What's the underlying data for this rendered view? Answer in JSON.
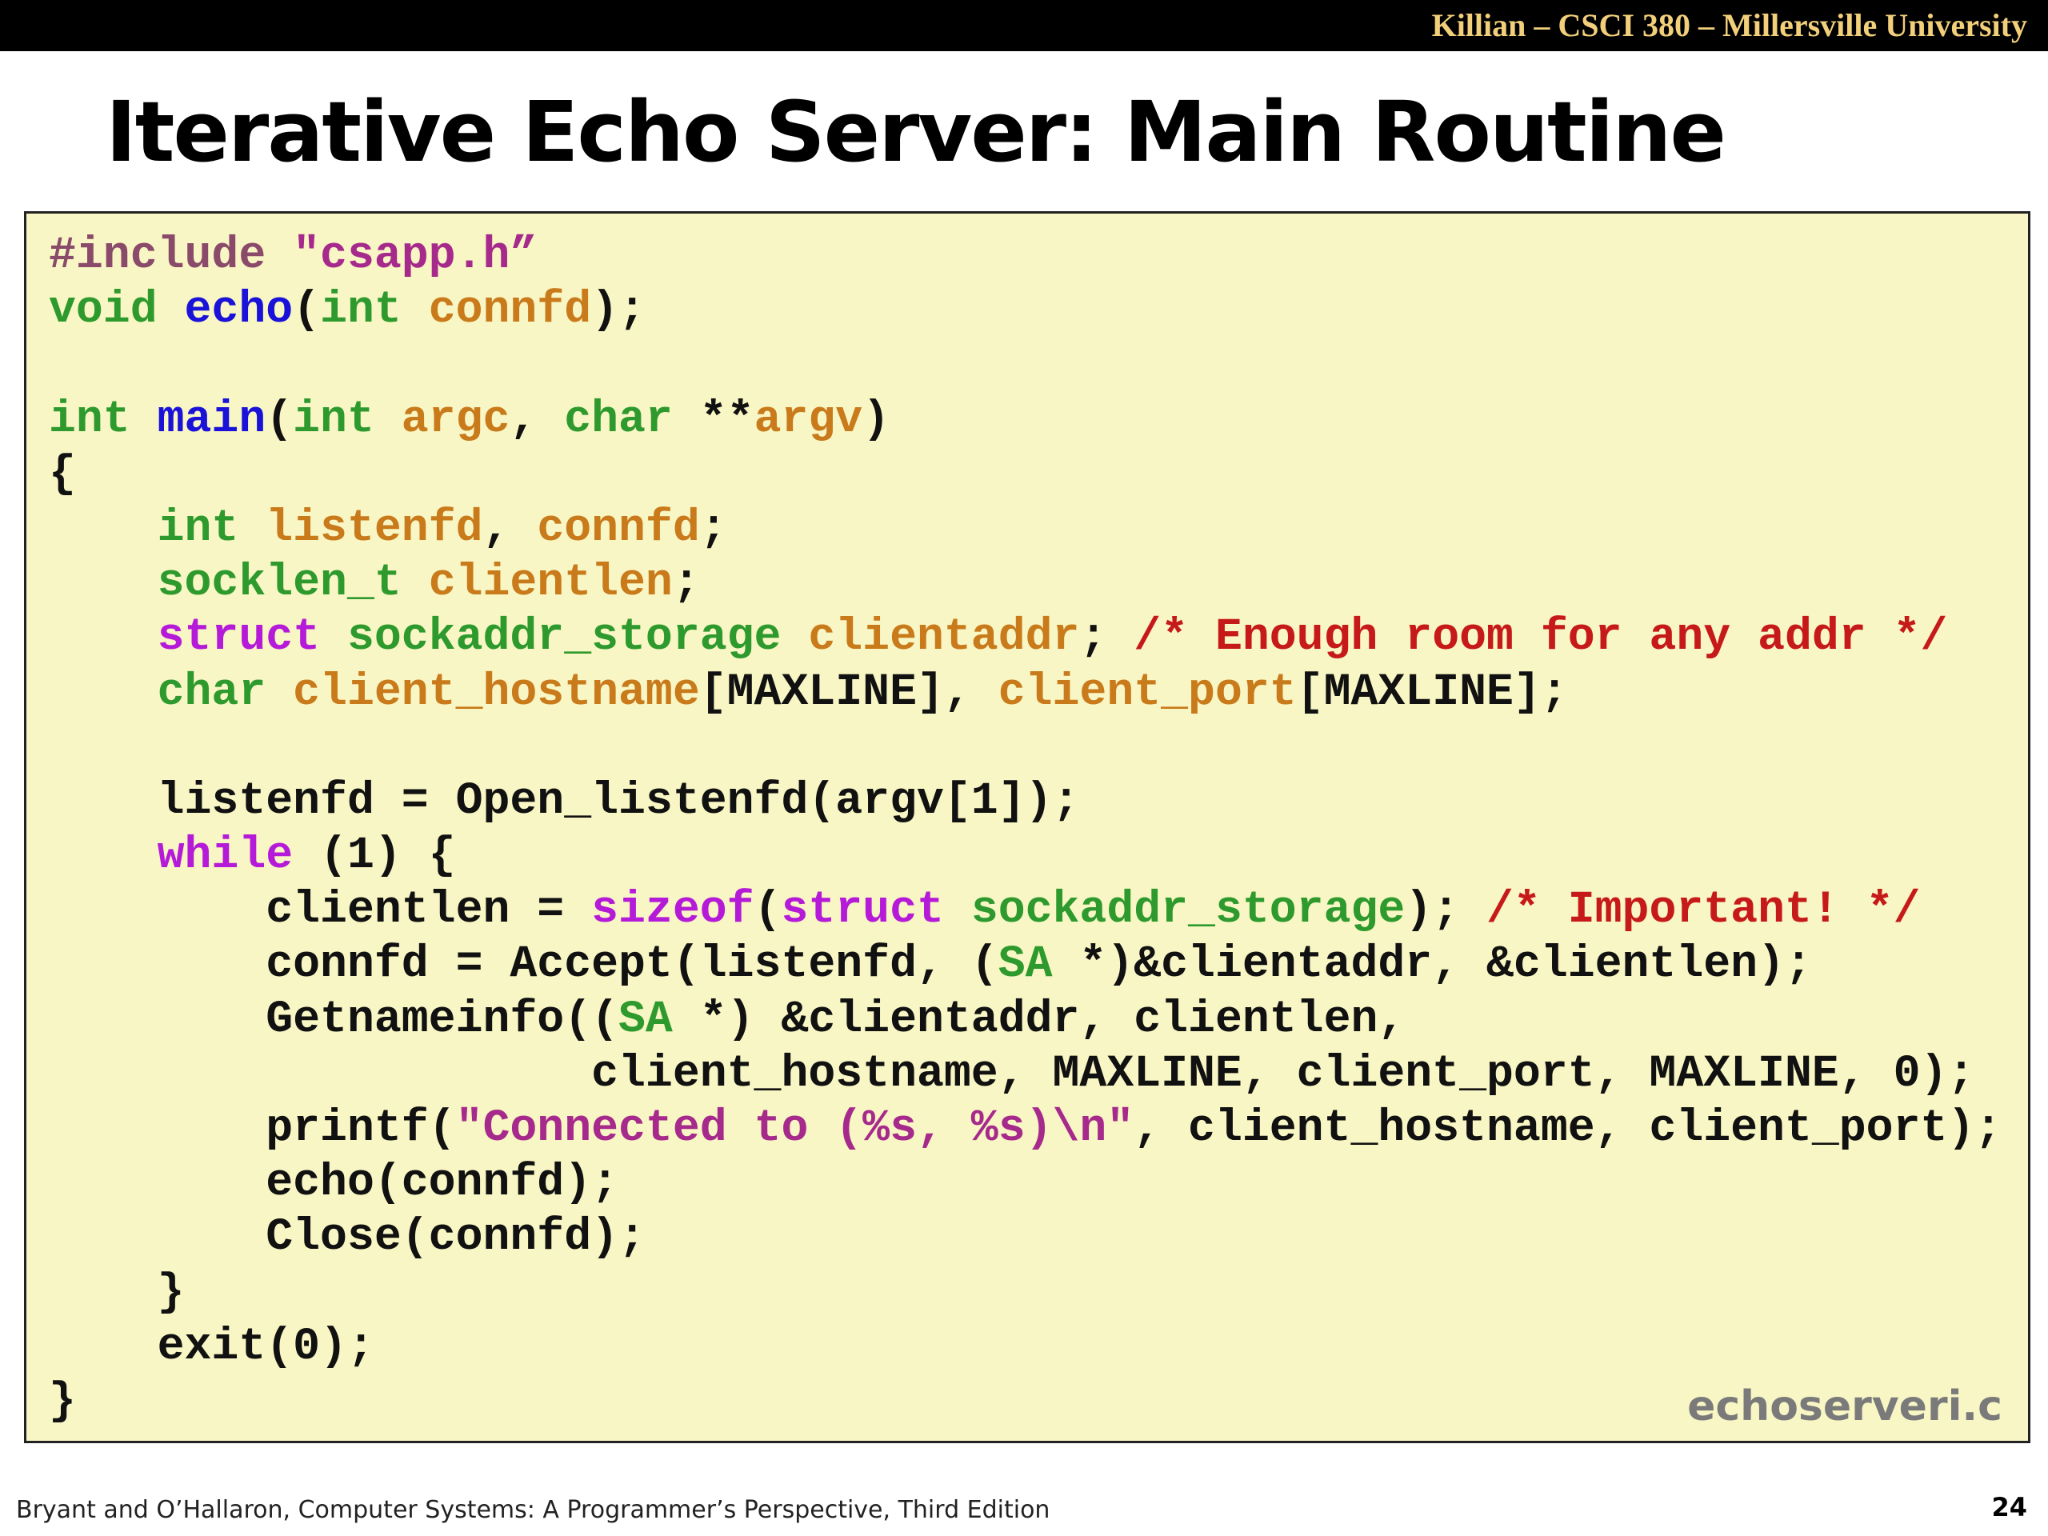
{
  "header": {
    "course": "Killian – CSCI 380 – Millersville University"
  },
  "slide": {
    "title": "Iterative Echo Server: Main Routine",
    "filename": "echoserveri.c",
    "footer": "Bryant and O’Hallaron, Computer Systems: A Programmer’s Perspective, Third Edition",
    "page_number": "24"
  },
  "colors": {
    "background": "#ffffff",
    "topbar": "#000000",
    "topbar_text": "#f2cf7a",
    "code_background": "#f8f6c4",
    "plain": "#111111",
    "type": "#2e9a2e",
    "identifier": "#c97a1a",
    "function": "#1a12d8",
    "keyword": "#b51ad8",
    "comment": "#c61a1a",
    "string": "#a62a8c",
    "directive": "#8a4a6a",
    "filename": "#7a7a7a"
  },
  "code": {
    "lines": [
      [
        {
          "t": "#include ",
          "k": "directive"
        },
        {
          "t": "\"csapp.h”",
          "k": "string"
        }
      ],
      [
        {
          "t": "void ",
          "k": "type"
        },
        {
          "t": "echo",
          "k": "function"
        },
        {
          "t": "(",
          "k": "plain"
        },
        {
          "t": "int ",
          "k": "type"
        },
        {
          "t": "connfd",
          "k": "identifier"
        },
        {
          "t": ");",
          "k": "plain"
        }
      ],
      [],
      [
        {
          "t": "int ",
          "k": "type"
        },
        {
          "t": "main",
          "k": "function"
        },
        {
          "t": "(",
          "k": "plain"
        },
        {
          "t": "int ",
          "k": "type"
        },
        {
          "t": "argc",
          "k": "identifier"
        },
        {
          "t": ", ",
          "k": "plain"
        },
        {
          "t": "char ",
          "k": "type"
        },
        {
          "t": "**",
          "k": "plain"
        },
        {
          "t": "argv",
          "k": "identifier"
        },
        {
          "t": ")",
          "k": "plain"
        }
      ],
      [
        {
          "t": "{",
          "k": "plain"
        }
      ],
      [
        {
          "t": "    ",
          "k": "plain"
        },
        {
          "t": "int ",
          "k": "type"
        },
        {
          "t": "listenfd",
          "k": "identifier"
        },
        {
          "t": ", ",
          "k": "plain"
        },
        {
          "t": "connfd",
          "k": "identifier"
        },
        {
          "t": ";",
          "k": "plain"
        }
      ],
      [
        {
          "t": "    ",
          "k": "plain"
        },
        {
          "t": "socklen_t ",
          "k": "type"
        },
        {
          "t": "clientlen",
          "k": "identifier"
        },
        {
          "t": ";",
          "k": "plain"
        }
      ],
      [
        {
          "t": "    ",
          "k": "plain"
        },
        {
          "t": "struct ",
          "k": "keyword"
        },
        {
          "t": "sockaddr_storage ",
          "k": "type"
        },
        {
          "t": "clientaddr",
          "k": "identifier"
        },
        {
          "t": "; ",
          "k": "plain"
        },
        {
          "t": "/* Enough room for any addr */",
          "k": "comment"
        }
      ],
      [
        {
          "t": "    ",
          "k": "plain"
        },
        {
          "t": "char ",
          "k": "type"
        },
        {
          "t": "client_hostname",
          "k": "identifier"
        },
        {
          "t": "[MAXLINE], ",
          "k": "plain"
        },
        {
          "t": "client_port",
          "k": "identifier"
        },
        {
          "t": "[MAXLINE];",
          "k": "plain"
        }
      ],
      [],
      [
        {
          "t": "    listenfd = Open_listenfd(argv[1]);",
          "k": "plain"
        }
      ],
      [
        {
          "t": "    ",
          "k": "plain"
        },
        {
          "t": "while",
          "k": "keyword"
        },
        {
          "t": " (1) {",
          "k": "plain"
        }
      ],
      [
        {
          "t": "        clientlen = ",
          "k": "plain"
        },
        {
          "t": "sizeof",
          "k": "keyword"
        },
        {
          "t": "(",
          "k": "plain"
        },
        {
          "t": "struct ",
          "k": "keyword"
        },
        {
          "t": "sockaddr_storage",
          "k": "type"
        },
        {
          "t": "); ",
          "k": "plain"
        },
        {
          "t": "/* Important! */",
          "k": "comment"
        }
      ],
      [
        {
          "t": "        connfd = Accept(listenfd, (",
          "k": "plain"
        },
        {
          "t": "SA",
          "k": "type"
        },
        {
          "t": " *)&clientaddr, &clientlen);",
          "k": "plain"
        }
      ],
      [
        {
          "t": "        Getnameinfo((",
          "k": "plain"
        },
        {
          "t": "SA",
          "k": "type"
        },
        {
          "t": " *) &clientaddr, clientlen,",
          "k": "plain"
        }
      ],
      [
        {
          "t": "                    client_hostname, MAXLINE, client_port, MAXLINE, 0);",
          "k": "plain"
        }
      ],
      [
        {
          "t": "        printf(",
          "k": "plain"
        },
        {
          "t": "\"Connected to (%s, %s)\\n\"",
          "k": "string"
        },
        {
          "t": ", client_hostname, client_port);",
          "k": "plain"
        }
      ],
      [
        {
          "t": "        echo(connfd);",
          "k": "plain"
        }
      ],
      [
        {
          "t": "        Close(connfd);",
          "k": "plain"
        }
      ],
      [
        {
          "t": "    }",
          "k": "plain"
        }
      ],
      [
        {
          "t": "    exit(0);",
          "k": "plain"
        }
      ],
      [
        {
          "t": "}",
          "k": "plain"
        }
      ]
    ]
  }
}
